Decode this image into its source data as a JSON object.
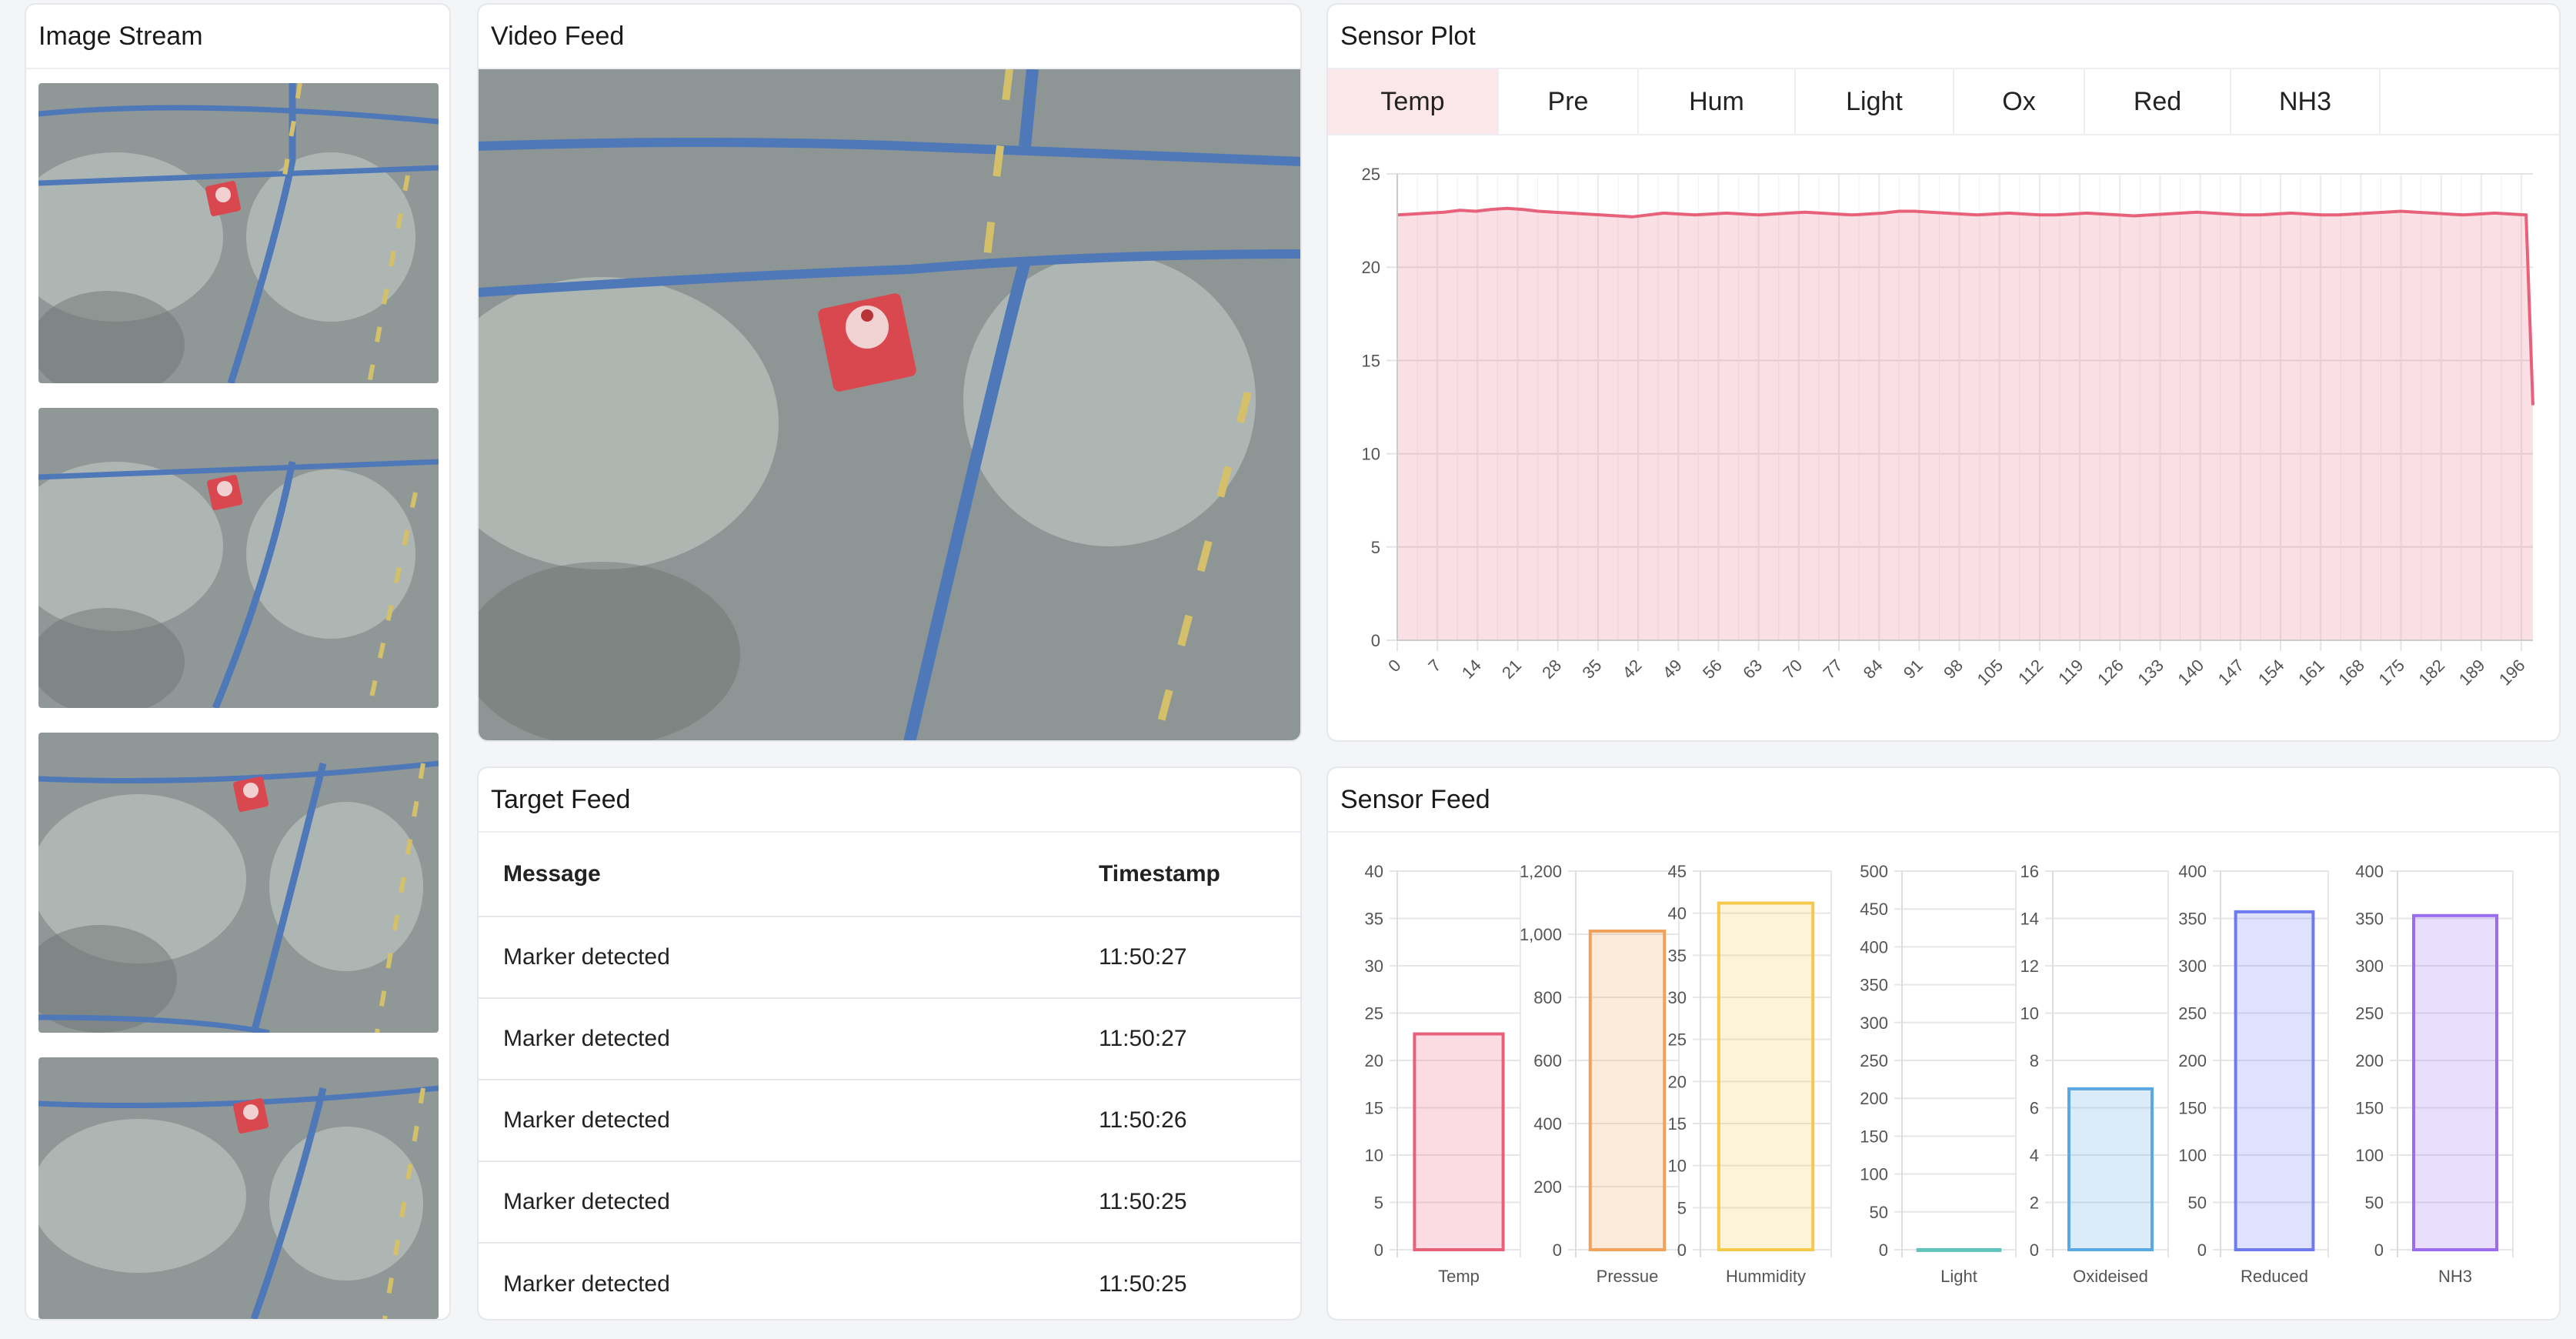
{
  "image_stream": {
    "title": "Image Stream",
    "thumbnail_count": 4
  },
  "video_feed": {
    "title": "Video Feed"
  },
  "sensor_plot": {
    "title": "Sensor Plot",
    "tabs": [
      "Temp",
      "Pre",
      "Hum",
      "Light",
      "Ox",
      "Red",
      "NH3"
    ],
    "active_tab": "Temp"
  },
  "target_feed": {
    "title": "Target Feed",
    "columns": {
      "message": "Message",
      "timestamp": "Timestamp"
    },
    "rows": [
      {
        "message": "Marker detected",
        "timestamp": "11:50:27"
      },
      {
        "message": "Marker detected",
        "timestamp": "11:50:27"
      },
      {
        "message": "Marker detected",
        "timestamp": "11:50:26"
      },
      {
        "message": "Marker detected",
        "timestamp": "11:50:25"
      },
      {
        "message": "Marker detected",
        "timestamp": "11:50:25"
      }
    ]
  },
  "sensor_feed": {
    "title": "Sensor Feed"
  },
  "colors": {
    "temp": "#e8617a",
    "pressure": "#f0a25a",
    "humidity": "#f5c94e",
    "light": "#61c2bb",
    "oxidised": "#5aa8e4",
    "reduced": "#6e7cf0",
    "nh3": "#9b6cf0"
  },
  "chart_data": [
    {
      "type": "area",
      "series": [
        {
          "values": [
            22.8,
            22.85,
            22.9,
            22.95,
            23.05,
            23.0,
            23.1,
            23.15,
            23.1,
            23.0,
            22.95,
            22.9,
            22.85,
            22.8,
            22.75,
            22.7,
            22.8,
            22.9,
            22.85,
            22.8,
            22.85,
            22.9,
            22.85,
            22.8,
            22.85,
            22.9,
            22.95,
            22.9,
            22.85,
            22.8,
            22.85,
            22.9,
            23.0,
            23.0,
            22.95,
            22.9,
            22.85,
            22.8,
            22.85,
            22.9,
            22.85,
            22.8,
            22.8,
            22.85,
            22.9,
            22.85,
            22.8,
            22.75,
            22.8,
            22.85,
            22.9,
            22.95,
            22.9,
            22.85,
            22.8,
            22.8,
            22.85,
            22.9,
            22.85,
            22.8,
            22.8,
            22.85,
            22.9,
            22.95,
            23.0,
            22.95,
            22.9,
            22.85,
            22.8,
            22.85,
            22.9,
            22.85,
            22.8,
            12.6
          ]
        }
      ],
      "x_tick_labels": [
        "0",
        "7",
        "14",
        "21",
        "28",
        "35",
        "42",
        "49",
        "56",
        "63",
        "70",
        "77",
        "84",
        "91",
        "98",
        "105",
        "112",
        "119",
        "126",
        "133",
        "140",
        "147",
        "154",
        "161",
        "168",
        "175",
        "182",
        "189",
        "196"
      ],
      "xlim": [
        0,
        198
      ],
      "ylim": [
        0,
        25
      ],
      "y_ticks": [
        "0",
        "5",
        "10",
        "15",
        "20",
        "25"
      ],
      "grid": true,
      "legend": "none"
    },
    {
      "type": "bar",
      "charts": [
        {
          "category": "Temp",
          "value": 22.8,
          "ylim": [
            0,
            40
          ],
          "ticks": [
            "0",
            "5",
            "10",
            "15",
            "20",
            "25",
            "30",
            "35",
            "40"
          ]
        },
        {
          "category": "Pressue",
          "value": 1010,
          "ylim": [
            0,
            1200
          ],
          "ticks": [
            "0",
            "200",
            "400",
            "600",
            "800",
            "1,000",
            "1,200"
          ]
        },
        {
          "category": "Hummidity",
          "value": 41.2,
          "ylim": [
            0,
            45
          ],
          "ticks": [
            "0",
            "5",
            "10",
            "15",
            "20",
            "25",
            "30",
            "35",
            "40",
            "45"
          ]
        },
        {
          "category": "Light",
          "value": 0.1,
          "ylim": [
            0,
            500
          ],
          "ticks": [
            "0",
            "50",
            "100",
            "150",
            "200",
            "250",
            "300",
            "350",
            "400",
            "450",
            "500"
          ]
        },
        {
          "category": "Oxideised",
          "value": 6.8,
          "ylim": [
            0,
            16
          ],
          "ticks": [
            "0",
            "2",
            "4",
            "6",
            "8",
            "10",
            "12",
            "14",
            "16"
          ]
        },
        {
          "category": "Reduced",
          "value": 357,
          "ylim": [
            0,
            400
          ],
          "ticks": [
            "0",
            "50",
            "100",
            "150",
            "200",
            "250",
            "300",
            "350",
            "400"
          ]
        },
        {
          "category": "NH3",
          "value": 353,
          "ylim": [
            0,
            400
          ],
          "ticks": [
            "0",
            "50",
            "100",
            "150",
            "200",
            "250",
            "300",
            "350",
            "400"
          ]
        }
      ]
    }
  ]
}
